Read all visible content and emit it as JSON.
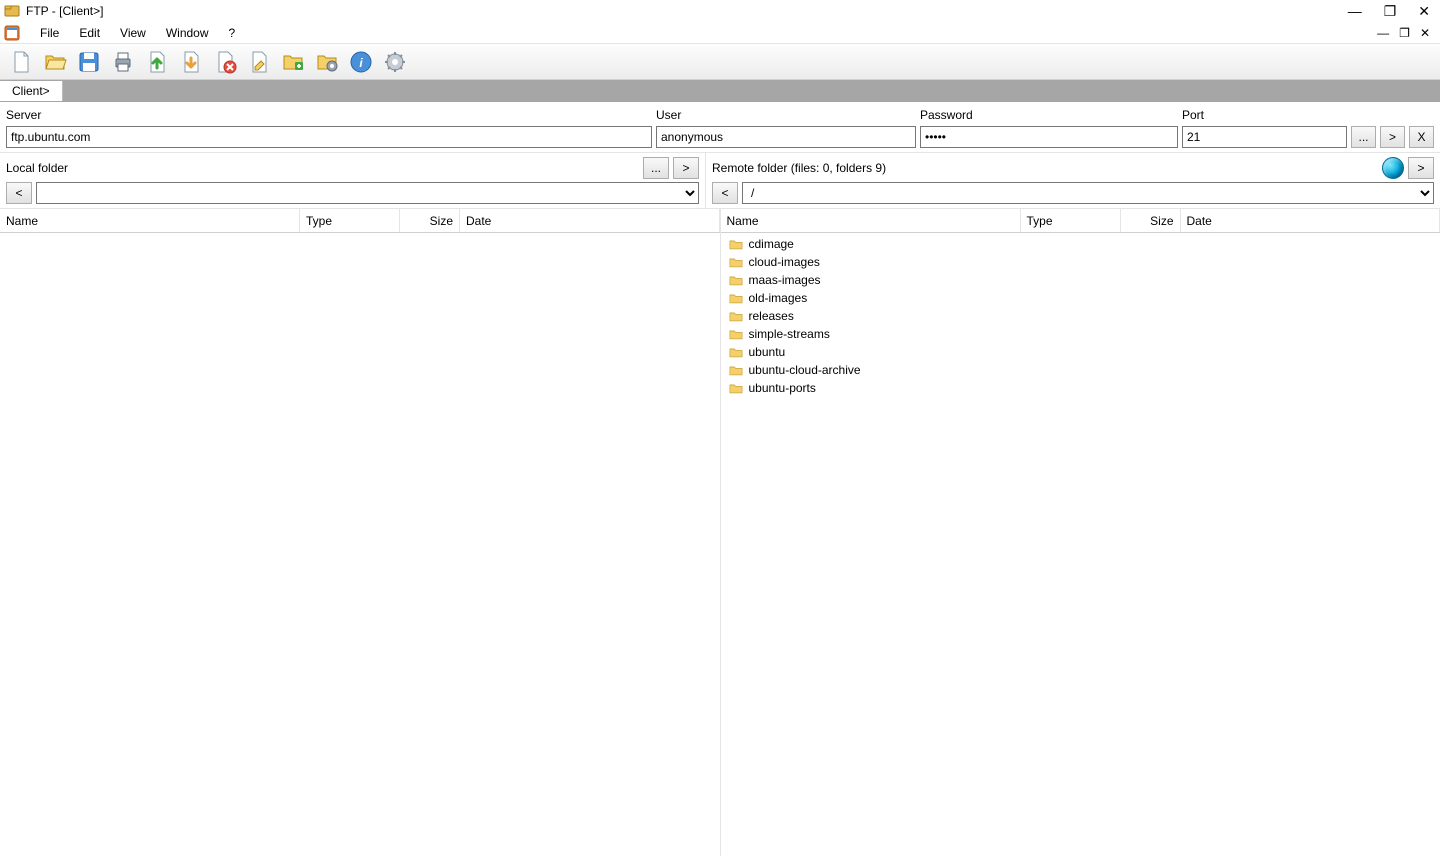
{
  "window": {
    "title": "FTP - [Client>]"
  },
  "menus": {
    "file": "File",
    "edit": "Edit",
    "view": "View",
    "window": "Window",
    "help": "?"
  },
  "toolbar": {
    "new_file": "New",
    "open": "Open",
    "save": "Save",
    "print": "Print",
    "upload": "Upload",
    "download": "Download",
    "delete": "Delete",
    "new_doc": "New Document",
    "new_folder": "New Folder",
    "settings": "Settings",
    "info": "Info",
    "gear": "Preferences"
  },
  "tabs": {
    "client": "Client>"
  },
  "connection": {
    "server_label": "Server",
    "server_value": "ftp.ubuntu.com",
    "user_label": "User",
    "user_value": "anonymous",
    "password_label": "Password",
    "password_value": "•••••",
    "port_label": "Port",
    "port_value": "21",
    "browse": "...",
    "go": ">",
    "close": "X"
  },
  "local": {
    "label": "Local folder",
    "path": "",
    "browse": "...",
    "go": ">",
    "back": "<"
  },
  "remote": {
    "label": "Remote folder (files: 0, folders 9)",
    "path": "/",
    "back": "<",
    "go": ">"
  },
  "columns": {
    "name": "Name",
    "type": "Type",
    "size": "Size",
    "date": "Date"
  },
  "remote_items": [
    {
      "name": "cdimage"
    },
    {
      "name": "cloud-images"
    },
    {
      "name": "maas-images"
    },
    {
      "name": "old-images"
    },
    {
      "name": "releases"
    },
    {
      "name": "simple-streams"
    },
    {
      "name": "ubuntu"
    },
    {
      "name": "ubuntu-cloud-archive"
    },
    {
      "name": "ubuntu-ports"
    }
  ]
}
